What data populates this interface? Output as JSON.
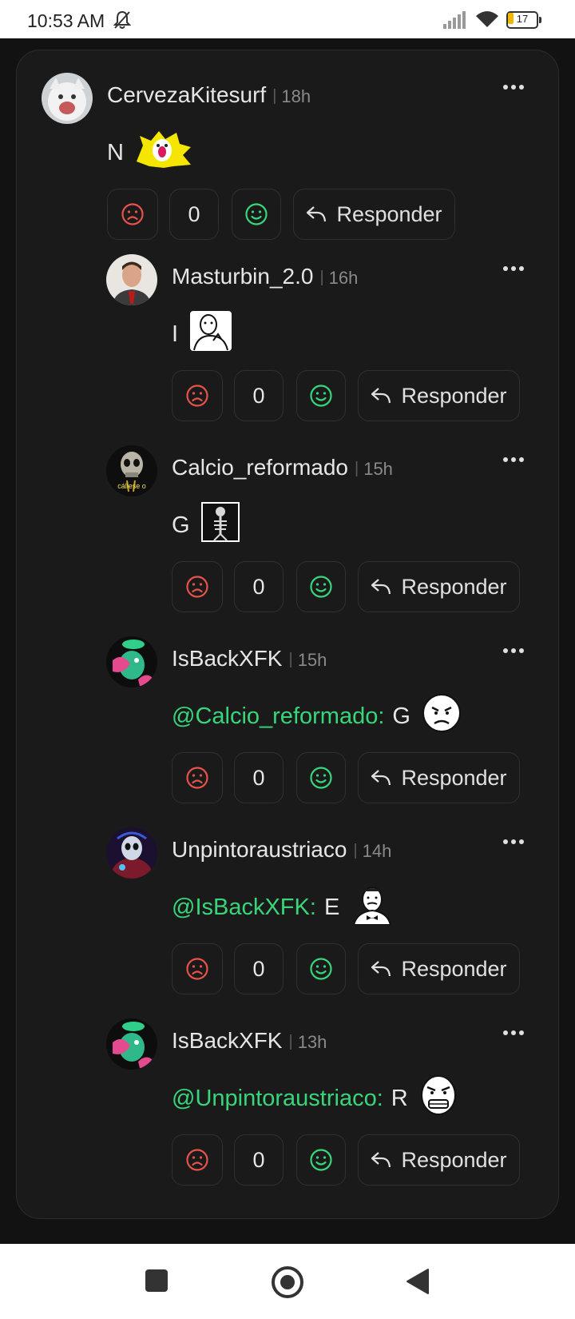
{
  "status_bar": {
    "time": "10:53 AM",
    "battery": "17"
  },
  "colors": {
    "accent": "#37d67a",
    "dislike": "#e5534b",
    "like": "#37d67a",
    "background": "#121212",
    "card": "#1a1a1a"
  },
  "comments": [
    {
      "username": "CervezaKitesurf",
      "separator": "|",
      "time": "18h",
      "mention": "",
      "text": "N",
      "count": "0",
      "reply_label": "Responder",
      "avatar": "white-cat-avatar",
      "emoji": "sticker-yellow-meme"
    },
    {
      "username": "Masturbin_2.0",
      "separator": "|",
      "time": "16h",
      "mention": "",
      "text": "I",
      "count": "0",
      "reply_label": "Responder",
      "avatar": "man-in-suit-avatar",
      "emoji": "thinking-meme-face"
    },
    {
      "username": "Calcio_reformado",
      "separator": "|",
      "time": "15h",
      "mention": "",
      "text": "G",
      "count": "0",
      "reply_label": "Responder",
      "avatar": "skull-avatar",
      "avatar_caption": "cállese o",
      "emoji": "skeleton-image"
    },
    {
      "username": "IsBackXFK",
      "separator": "|",
      "time": "15h",
      "mention": "@Calcio_reformado:",
      "text": "G",
      "count": "0",
      "reply_label": "Responder",
      "avatar": "green-creature-avatar",
      "emoji": "rage-meme-face"
    },
    {
      "username": "Unpintoraustriaco",
      "separator": "|",
      "time": "14h",
      "mention": "@IsBackXFK:",
      "text": "E",
      "count": "0",
      "reply_label": "Responder",
      "avatar": "dark-skull-avatar",
      "emoji": "not-bad-meme-face"
    },
    {
      "username": "IsBackXFK",
      "separator": "|",
      "time": "13h",
      "mention": "@Unpintoraustriaco:",
      "text": "R",
      "count": "0",
      "reply_label": "Responder",
      "avatar": "green-creature-avatar",
      "emoji": "fuuu-meme-face"
    }
  ],
  "nav": {
    "recents": "square-icon",
    "home": "circle-icon",
    "back": "triangle-back-icon"
  }
}
